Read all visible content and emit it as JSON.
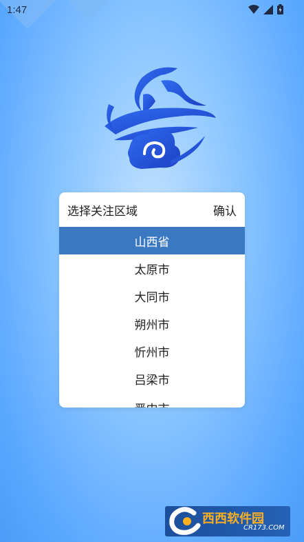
{
  "status_bar": {
    "time": "1:47"
  },
  "dialog": {
    "title": "选择关注区域",
    "confirm_label": "确认",
    "items": [
      "山西省",
      "太原市",
      "大同市",
      "朔州市",
      "忻州市",
      "吕梁市",
      "晋中市"
    ],
    "selected_index": 0
  },
  "watermark": {
    "brand": "西西软件园",
    "url": "CR173.COM"
  },
  "colors": {
    "selected_row": "#3a79c1",
    "logo_blue": "#2b59d8"
  }
}
